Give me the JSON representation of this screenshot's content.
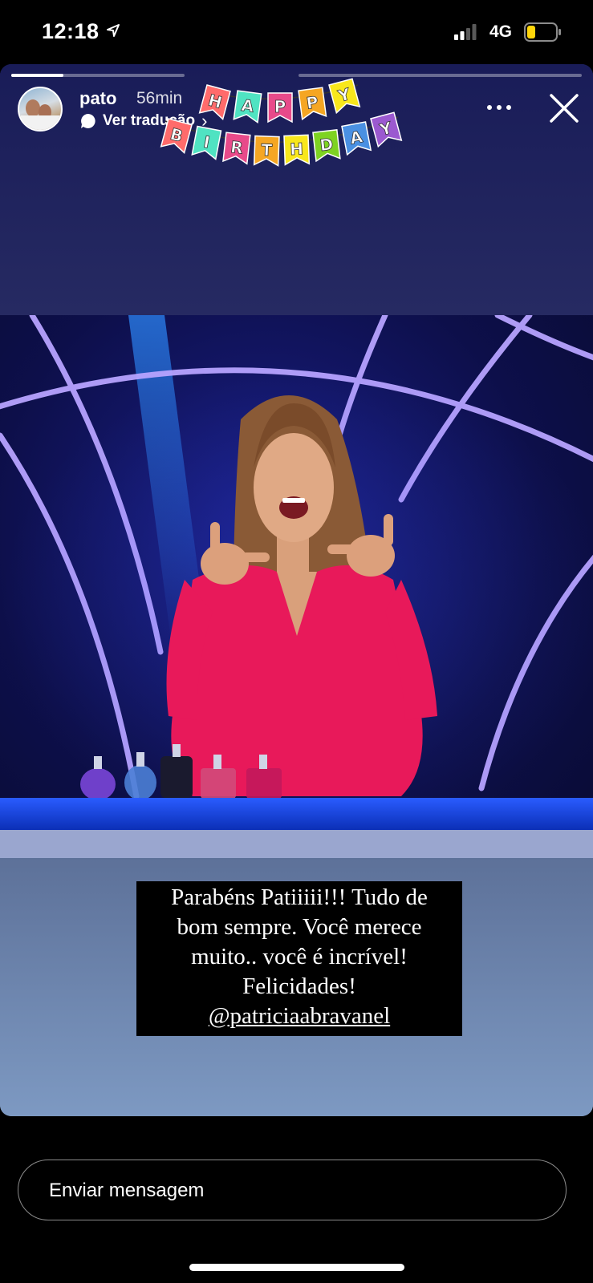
{
  "status_bar": {
    "time": "12:18",
    "location_icon": "location-arrow-icon",
    "signal_icon": "cellular-signal-icon",
    "network": "4G",
    "battery_icon": "battery-low-icon",
    "battery_color": "#ffd60a"
  },
  "story": {
    "progress": [
      {
        "fill": 0.3
      },
      {
        "fill": 0
      }
    ],
    "user": {
      "username": "pato",
      "time_ago": "56min",
      "avatar_icon": "profile-avatar"
    },
    "translate_label": "Ver tradução",
    "translate_chevron": "›",
    "sticker": {
      "line1": [
        "H",
        "A",
        "P",
        "P",
        "Y"
      ],
      "line2": [
        "B",
        "I",
        "R",
        "T",
        "H",
        "D",
        "A",
        "Y"
      ]
    },
    "caption": {
      "lines": [
        "Parabéns Patiiiii!!! Tudo de",
        "bom sempre. Você merece",
        "muito.. você é incrível!",
        "Felicidades!"
      ],
      "mention": "@patriciaabravanel"
    },
    "more_icon": "more-horizontal-icon",
    "close_icon": "close-icon"
  },
  "reply": {
    "placeholder": "Enviar mensagem"
  },
  "colors": {
    "background": "#000000",
    "story_top": "#1d1f5c",
    "story_bottom": "#7e9bc2",
    "dress": "#e8195a"
  }
}
